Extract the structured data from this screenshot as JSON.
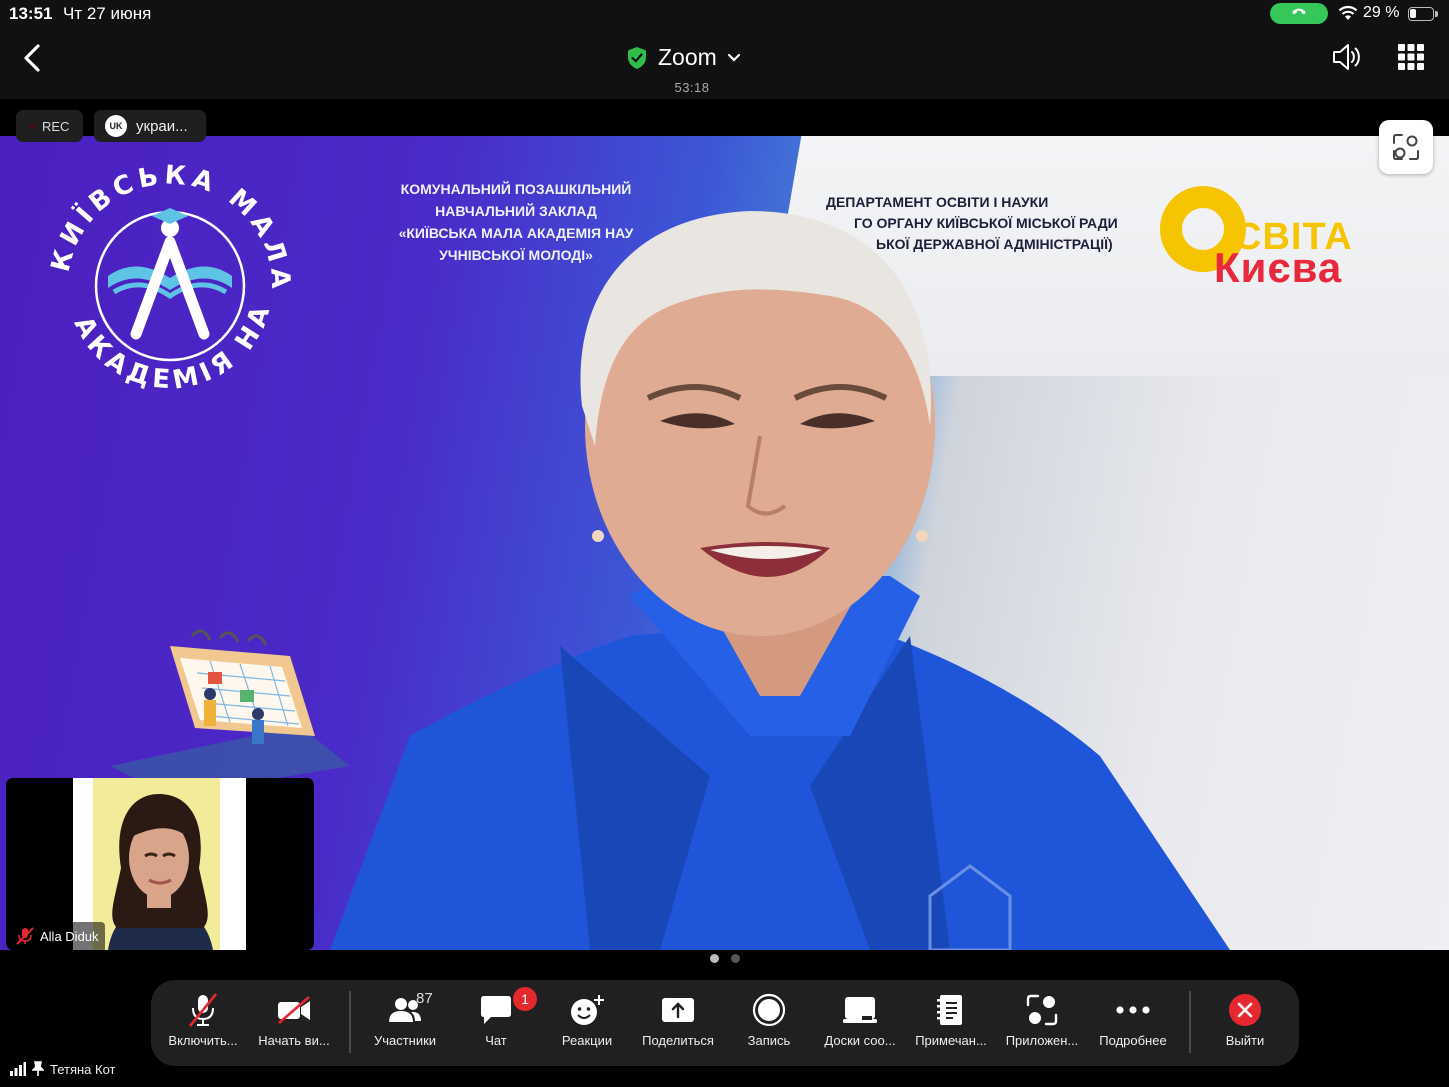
{
  "status_bar": {
    "time": "13:51",
    "date": "Чт 27 июня",
    "battery_percent": 29,
    "battery_text": "29 %",
    "call_color": "#35c759"
  },
  "header": {
    "title": "Zoom",
    "timer": "53:18",
    "shield_color": "#2fbe4a",
    "icons": [
      "chevron-left-icon",
      "shield-check-icon",
      "chevron-down-icon",
      "speaker-icon",
      "grid-icon"
    ]
  },
  "badges": {
    "rec_label": "REC",
    "lang_code": "UK",
    "lang_label": "украи..."
  },
  "video": {
    "banner_left_lines": [
      "КОМУНАЛЬНИЙ ПОЗАШКІЛЬНИЙ",
      "НАВЧАЛЬНИЙ ЗАКЛАД",
      "«КИЇВСЬКА МАЛА АКАДЕМІЯ НАУ",
      "УЧНІВСЬКОЇ МОЛОДІ»"
    ],
    "banner_right_lines": [
      "ДЕПАРТАМЕНТ ОСВІТИ І НАУКИ",
      "ГО ОРГАНУ КИЇВСЬКОЇ МІСЬКОЇ РАДИ",
      "ЬКОЇ ДЕРЖАВНОЇ АДМІНІСТРАЦІЇ)"
    ],
    "osvita_line1": "СВІТА",
    "osvita_line2": "Києва",
    "academy_arc_top": "КИЇВСЬКА МАЛА",
    "academy_arc_bottom": "АКАДЕМІЯ НАУК"
  },
  "thumbnail": {
    "participant_name": "Alla Diduk",
    "muted": true
  },
  "page_indicator": {
    "pages": 2,
    "current": 1
  },
  "toolbar": {
    "unmute": "Включить...",
    "start_video": "Начать ви...",
    "participants": "Участники",
    "participants_count": "87",
    "chat": "Чат",
    "chat_badge": "1",
    "reactions": "Реакции",
    "share": "Поделиться",
    "record": "Запись",
    "whiteboards": "Доски соо...",
    "notes": "Примечан...",
    "apps": "Приложен...",
    "more": "Подробнее",
    "leave": "Выйти",
    "leave_color": "#e5282e",
    "muted_color": "#e5282e"
  },
  "bottom_status": {
    "user_name": "Тетяна Кот"
  }
}
